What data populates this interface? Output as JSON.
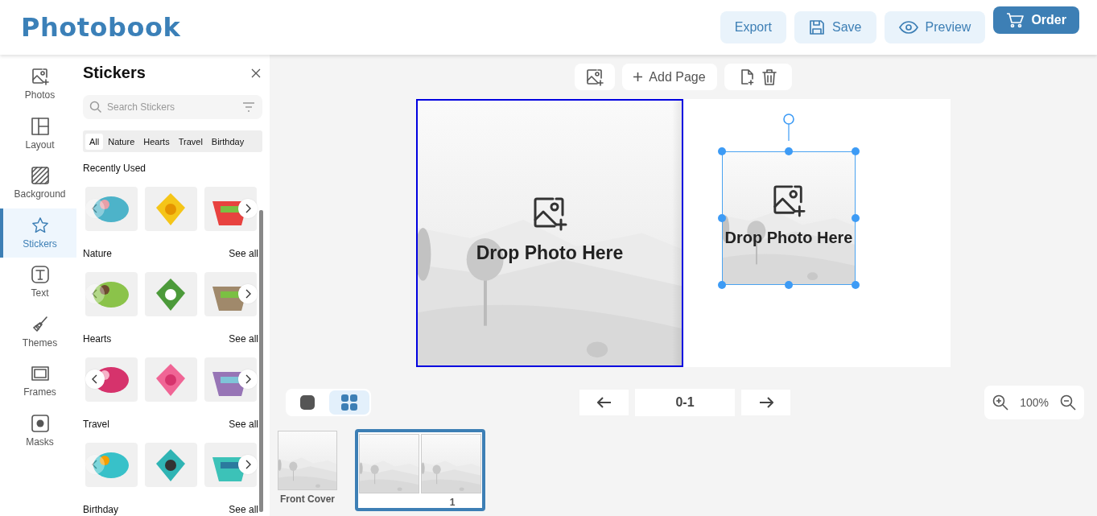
{
  "app": {
    "title": "Photobook"
  },
  "header_buttons": [
    {
      "label": "Export",
      "kind": "plain"
    },
    {
      "label": "Save",
      "kind": "save"
    },
    {
      "label": "Preview",
      "kind": "preview"
    },
    {
      "label": "Order",
      "kind": "order"
    }
  ],
  "sidebar": {
    "items": [
      {
        "label": "Photos",
        "kind": "photos",
        "selected": false
      },
      {
        "label": "Layout",
        "kind": "layout",
        "selected": false
      },
      {
        "label": "Background",
        "kind": "background",
        "selected": false
      },
      {
        "label": "Stickers",
        "kind": "stickers",
        "selected": true
      },
      {
        "label": "Text",
        "kind": "text",
        "selected": false
      },
      {
        "label": "Themes",
        "kind": "themes",
        "selected": false
      },
      {
        "label": "Frames",
        "kind": "frames",
        "selected": false
      },
      {
        "label": "Masks",
        "kind": "masks",
        "selected": false
      }
    ]
  },
  "panel": {
    "title": "Stickers",
    "search": {
      "placeholder": "Search Stickers"
    },
    "filters": [
      {
        "label": "All",
        "selected": true
      },
      {
        "label": "Nature",
        "selected": false
      },
      {
        "label": "Hearts",
        "selected": false
      },
      {
        "label": "Travel",
        "selected": false
      },
      {
        "label": "Birthday",
        "selected": false
      }
    ],
    "sections": [
      {
        "title": "Recently Used",
        "prev_active": false
      },
      {
        "title": "Nature",
        "link": "See all",
        "prev_active": false
      },
      {
        "title": "Hearts",
        "link": "See all",
        "prev_active": true
      },
      {
        "title": "Travel",
        "link": "See all",
        "prev_active": false
      },
      {
        "title": "Birthday",
        "link": "See all"
      }
    ]
  },
  "toolbar": {
    "add_page": "Add Page"
  },
  "spread": {
    "pages": [
      {
        "selected": true,
        "slot": {
          "text": "Drop Photo Here"
        }
      },
      {
        "selected": false,
        "element": {
          "text": "Drop Photo Here",
          "selected": true
        }
      }
    ]
  },
  "view_modes": [
    {
      "kind": "single",
      "selected": false
    },
    {
      "kind": "grid",
      "selected": true
    }
  ],
  "pager": {
    "label": "0-1"
  },
  "zoom": {
    "label": "100%"
  },
  "thumbnails": [
    {
      "label": "Front Cover",
      "kind": "single",
      "selected": false
    },
    {
      "label": "1",
      "kind": "spread",
      "selected": true
    }
  ]
}
